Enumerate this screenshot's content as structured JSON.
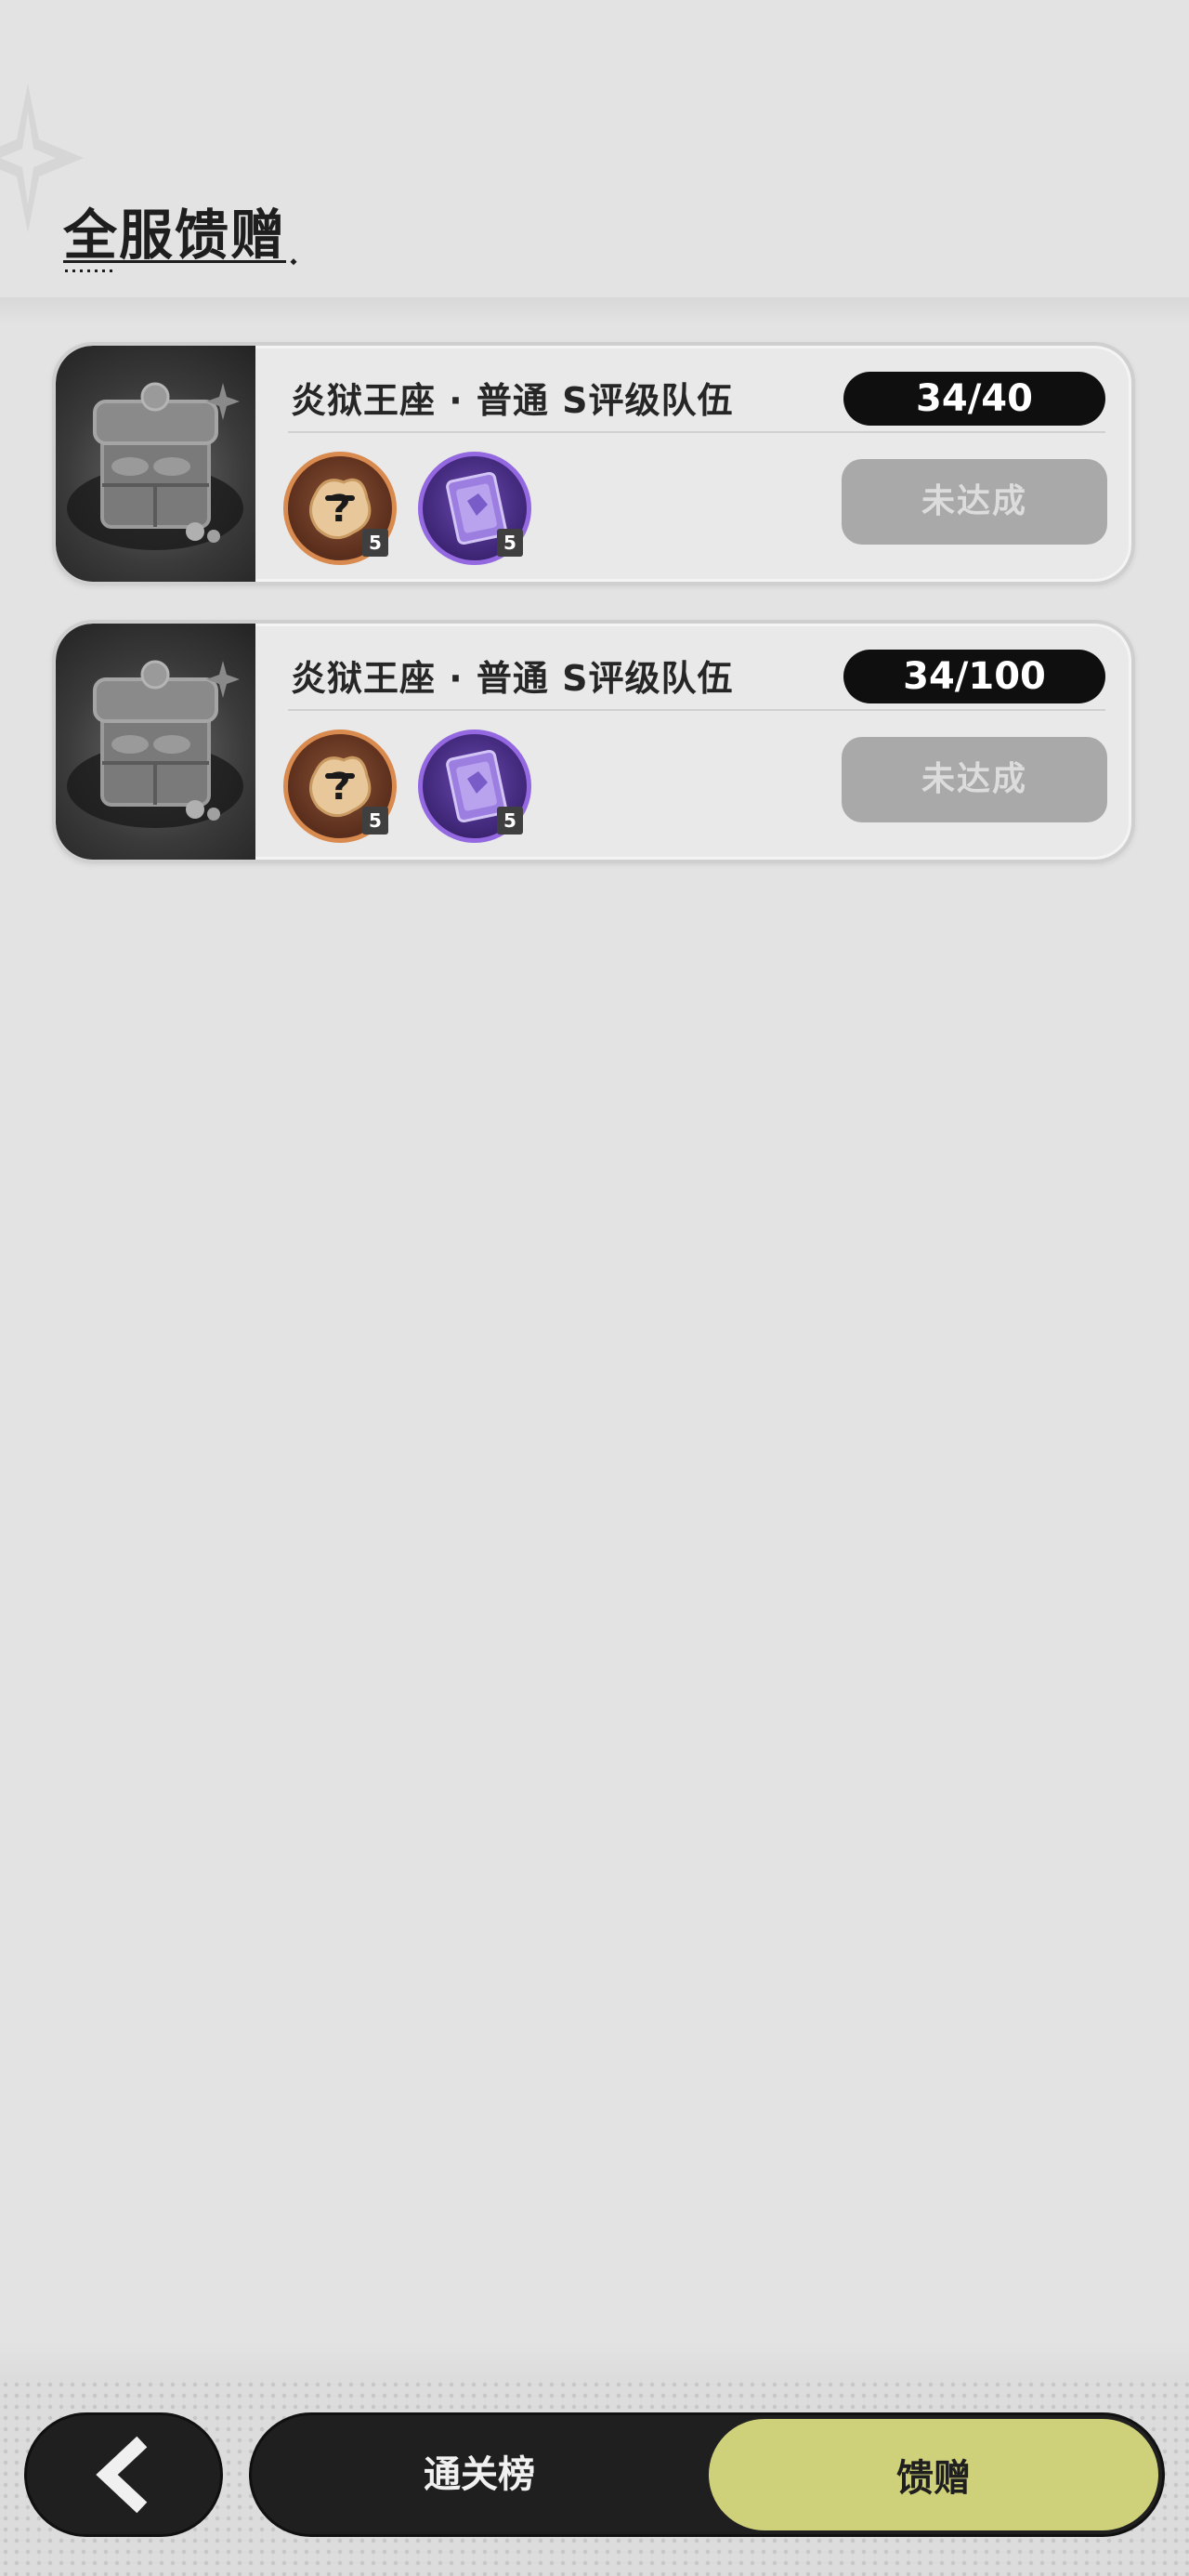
{
  "page": {
    "title": "全服馈赠"
  },
  "rewards": [
    {
      "title": "炎狱王座 · 普通 S评级队伍",
      "progress": "34/40",
      "status": "未达成",
      "items": [
        {
          "icon": "mystery-coin-icon",
          "qty": "5"
        },
        {
          "icon": "purple-card-icon",
          "qty": "5"
        }
      ]
    },
    {
      "title": "炎狱王座 · 普通 S评级队伍",
      "progress": "34/100",
      "status": "未达成",
      "items": [
        {
          "icon": "mystery-coin-icon",
          "qty": "5"
        },
        {
          "icon": "purple-card-icon",
          "qty": "5"
        }
      ]
    }
  ],
  "bottom_nav": {
    "back_icon": "chevron-left-icon",
    "tabs": [
      {
        "label": "通关榜",
        "active": false
      },
      {
        "label": "馈赠",
        "active": true
      }
    ]
  },
  "colors": {
    "background": "#e3e3e3",
    "active_tab": "#cfd17a",
    "nav_dark": "#1f1f1f",
    "status_disabled": "#a9a9a9",
    "progress_pill": "#0f0f0f"
  }
}
